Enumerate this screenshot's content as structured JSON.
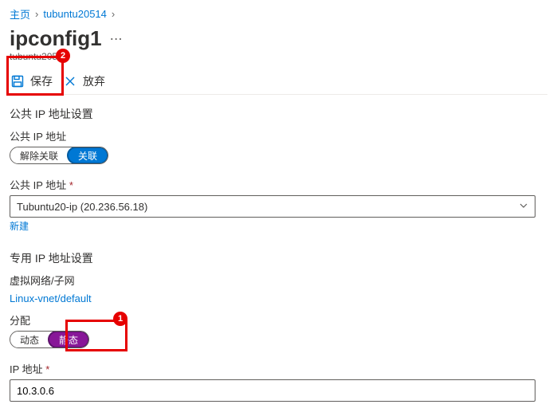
{
  "breadcrumb": {
    "home": "主页",
    "parent": "tubuntu20514"
  },
  "header": {
    "title": "ipconfig1",
    "subtitle": "tubuntu20514"
  },
  "commands": {
    "save": "保存",
    "discard": "放弃"
  },
  "callouts": {
    "num1": "1",
    "num2": "2"
  },
  "publicIp": {
    "sectionTitle": "公共 IP 地址设置",
    "addressLabel": "公共 IP 地址",
    "toggle": {
      "disassociate": "解除关联",
      "associate": "关联"
    },
    "selectLabel": "公共 IP 地址",
    "selectedValue": "Tubuntu20-ip (20.236.56.18)",
    "newLink": "新建"
  },
  "privateIp": {
    "sectionTitle": "专用 IP 地址设置",
    "vnetLabel": "虚拟网络/子网",
    "vnetLink": "Linux-vnet/default",
    "allocLabel": "分配",
    "alloc": {
      "dynamic": "动态",
      "static": "静态"
    },
    "ipLabel": "IP 地址",
    "ipValue": "10.3.0.6"
  }
}
